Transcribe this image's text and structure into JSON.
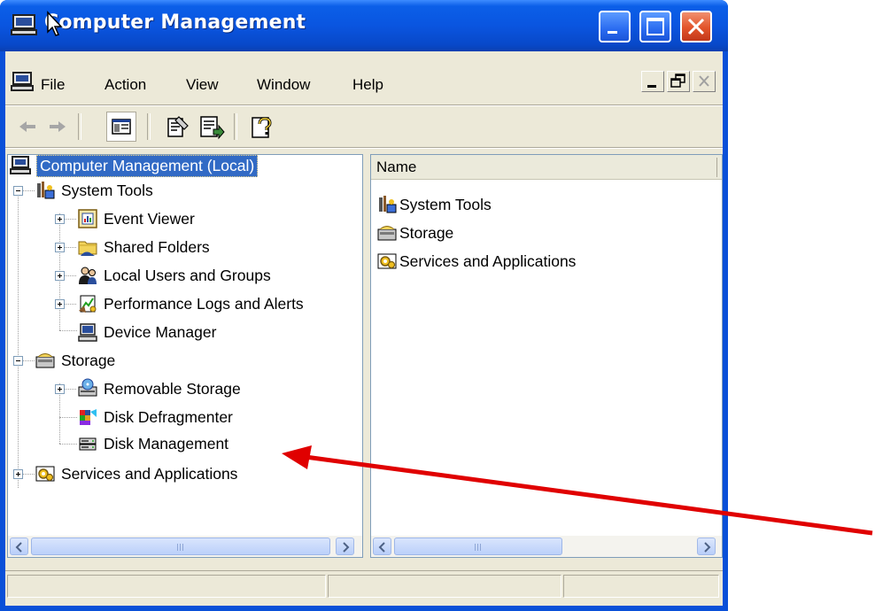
{
  "window": {
    "title": "Computer Management",
    "controls": [
      "minimize",
      "maximize",
      "close"
    ]
  },
  "menubar": {
    "items": [
      "File",
      "Action",
      "View",
      "Window",
      "Help"
    ]
  },
  "toolbar": {
    "buttons": [
      "back-arrow-icon",
      "forward-arrow-icon",
      "show-hide-tree-icon",
      "properties-icon",
      "export-list-icon",
      "help-icon"
    ]
  },
  "tree": {
    "root": "Computer Management (Local)",
    "system_tools": "System Tools",
    "event_viewer": "Event Viewer",
    "shared_folders": "Shared Folders",
    "local_users": "Local Users and Groups",
    "perf_logs": "Performance Logs and Alerts",
    "device_manager": "Device Manager",
    "storage": "Storage",
    "removable_storage": "Removable Storage",
    "disk_defrag": "Disk Defragmenter",
    "disk_mgmt": "Disk Management",
    "services_apps": "Services and Applications"
  },
  "list": {
    "column_name": "Name",
    "items": [
      "System Tools",
      "Storage",
      "Services and Applications"
    ]
  },
  "colors": {
    "title_blue": "#0A55E0",
    "selection": "#316AC5",
    "annotation_arrow": "#E00000"
  }
}
